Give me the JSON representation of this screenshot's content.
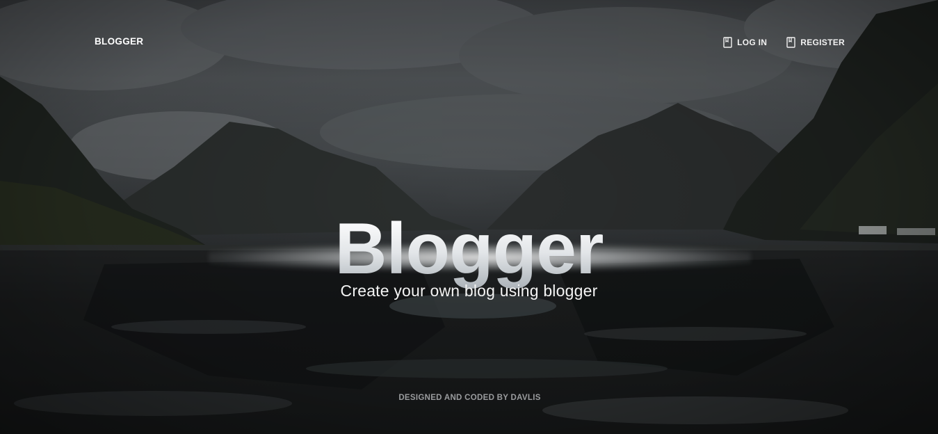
{
  "nav": {
    "brand": "BLOGGER",
    "links": [
      {
        "label": "LOG IN",
        "icon": "book-icon"
      },
      {
        "label": "REGISTER",
        "icon": "book-icon"
      }
    ]
  },
  "hero": {
    "title": "Blogger",
    "tagline": "Create your own blog using blogger",
    "background": "misty-fjord-mountains-lake"
  },
  "footer": {
    "credit": "DESIGNED AND CODED BY DAVLIS"
  },
  "colors": {
    "text": "#ffffff",
    "muted": "#9a9c9e",
    "background_dark": "#1b1d1f"
  }
}
